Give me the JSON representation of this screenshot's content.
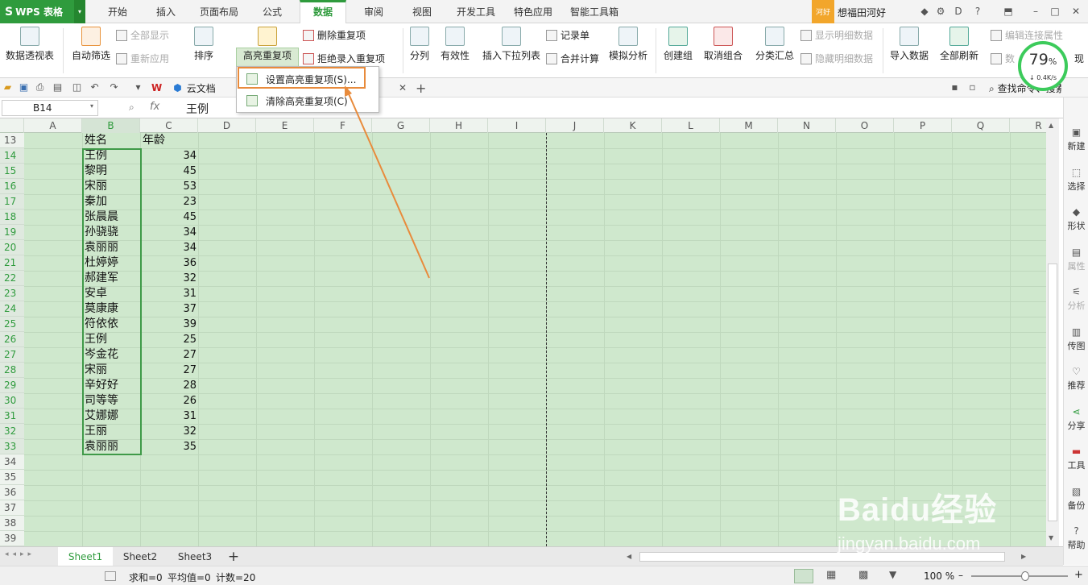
{
  "app": {
    "name": "WPS 表格"
  },
  "tabs": [
    "开始",
    "插入",
    "页面布局",
    "公式",
    "数据",
    "审阅",
    "视图",
    "开发工具",
    "特色应用",
    "智能工具箱"
  ],
  "active_tab": "数据",
  "user": {
    "badge": "河好",
    "name": "想福田河好"
  },
  "ribbon": {
    "pivot": "数据透视表",
    "autofilter": "自动筛选",
    "show_all": "全部显示",
    "reapply": "重新应用",
    "sort": "排序",
    "highlight_dup": "高亮重复项",
    "delete_dup": "删除重复项",
    "reject_dup": "拒绝录入重复项",
    "split": "分列",
    "validity": "有效性",
    "insert_dropdown": "插入下拉列表",
    "record": "记录单",
    "consolidate": "合并计算",
    "simulate": "模拟分析",
    "group": "创建组",
    "ungroup": "取消组合",
    "subtotal": "分类汇总",
    "show_detail": "显示明细数据",
    "hide_detail": "隐藏明细数据",
    "import": "导入数据",
    "refresh_all": "全部刷新",
    "edit_link": "编辑连接属性",
    "data_short": "数",
    "cut_label": "现"
  },
  "gauge": {
    "percent": "79",
    "speed": "0.4K/s"
  },
  "quickbar": {
    "cloud_doc": "云文档",
    "search": "查找命令、搜索模板"
  },
  "formula_bar": {
    "cell_ref": "B14",
    "fx": "fx",
    "value": "王例"
  },
  "dropdown": {
    "item1": "设置高亮重复项(S)...",
    "item2": "清除高亮重复项(C)"
  },
  "columns": [
    "A",
    "B",
    "C",
    "D",
    "E",
    "F",
    "G",
    "H",
    "I",
    "J",
    "K",
    "L",
    "M",
    "N",
    "O",
    "P",
    "Q",
    "R"
  ],
  "header_row": {
    "row": "13",
    "name": "姓名",
    "age": "年龄"
  },
  "rows": [
    {
      "row": "14",
      "name": "王例",
      "age": "34"
    },
    {
      "row": "15",
      "name": "黎明",
      "age": "45"
    },
    {
      "row": "16",
      "name": "宋丽",
      "age": "53"
    },
    {
      "row": "17",
      "name": "秦加",
      "age": "23"
    },
    {
      "row": "18",
      "name": "张晨晨",
      "age": "45"
    },
    {
      "row": "19",
      "name": "孙骁骁",
      "age": "34"
    },
    {
      "row": "20",
      "name": "袁丽丽",
      "age": "34"
    },
    {
      "row": "21",
      "name": "杜婷婷",
      "age": "36"
    },
    {
      "row": "22",
      "name": "郝建军",
      "age": "32"
    },
    {
      "row": "23",
      "name": "安卓",
      "age": "31"
    },
    {
      "row": "24",
      "name": "莫康康",
      "age": "37"
    },
    {
      "row": "25",
      "name": "符依依",
      "age": "39"
    },
    {
      "row": "26",
      "name": "王例",
      "age": "25"
    },
    {
      "row": "27",
      "name": "岑金花",
      "age": "27"
    },
    {
      "row": "28",
      "name": "宋丽",
      "age": "27"
    },
    {
      "row": "29",
      "name": "辛好好",
      "age": "28"
    },
    {
      "row": "30",
      "name": "司等等",
      "age": "26"
    },
    {
      "row": "31",
      "name": "艾娜娜",
      "age": "31"
    },
    {
      "row": "32",
      "name": "王丽",
      "age": "32"
    },
    {
      "row": "33",
      "name": "袁丽丽",
      "age": "35"
    }
  ],
  "empty_rows": [
    "34",
    "35",
    "36",
    "37",
    "38",
    "39"
  ],
  "right_panel": [
    "新建",
    "选择",
    "形状",
    "属性",
    "分析",
    "传图",
    "推荐",
    "分享",
    "工具",
    "备份",
    "帮助"
  ],
  "sheets": [
    "Sheet1",
    "Sheet2",
    "Sheet3"
  ],
  "status": {
    "sum": "求和=0",
    "avg": "平均值=0",
    "count": "计数=20",
    "zoom": "100 %"
  },
  "watermark": {
    "brand": "Baidu经验",
    "url": "jingyan.baidu.com"
  },
  "colors": {
    "accent": "#2f9b3d",
    "grid": "#cfe8cd",
    "highlight": "#e88b3c"
  }
}
